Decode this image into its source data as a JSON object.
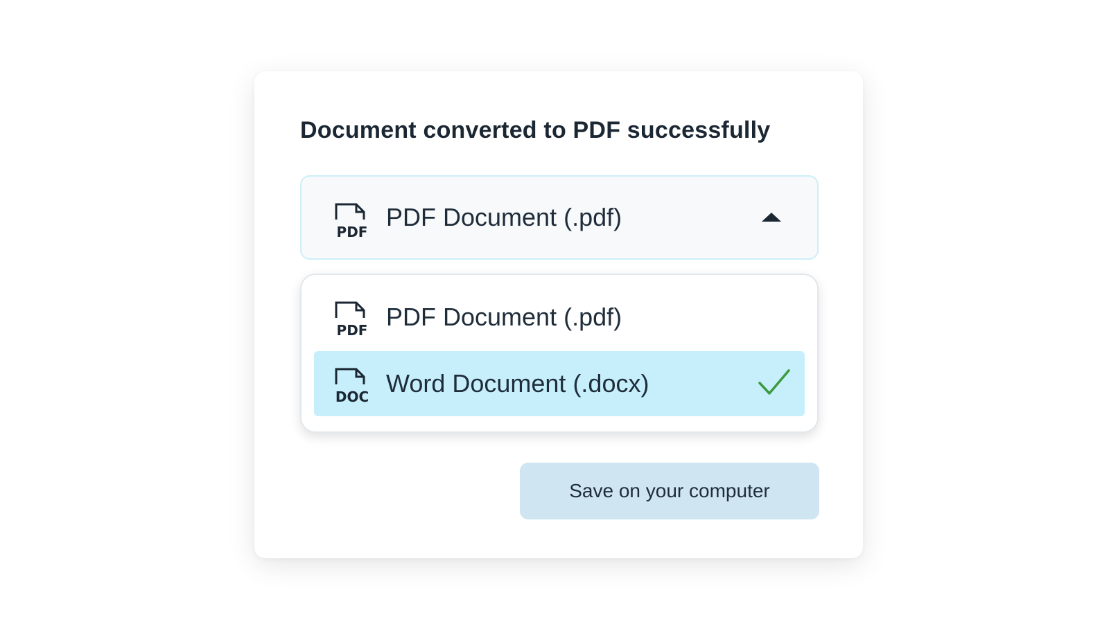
{
  "dialog": {
    "title": "Document converted to PDF successfully"
  },
  "format_select": {
    "selected_label": "PDF Document (.pdf)",
    "selected_icon": "pdf-file-icon",
    "selected_icon_text": "PDF",
    "expanded": true
  },
  "format_options": [
    {
      "label": "PDF Document (.pdf)",
      "icon": "pdf-file-icon",
      "icon_text": "PDF",
      "checked": false
    },
    {
      "label": "Word Document (.docx)",
      "icon": "doc-file-icon",
      "icon_text": "DOC",
      "checked": true
    }
  ],
  "actions": {
    "save_label": "Save on your computer"
  },
  "colors": {
    "highlight": "#c6eefb",
    "check": "#3b9a3d",
    "button_bg": "#cfe5f1",
    "text": "#1f2d3a"
  }
}
